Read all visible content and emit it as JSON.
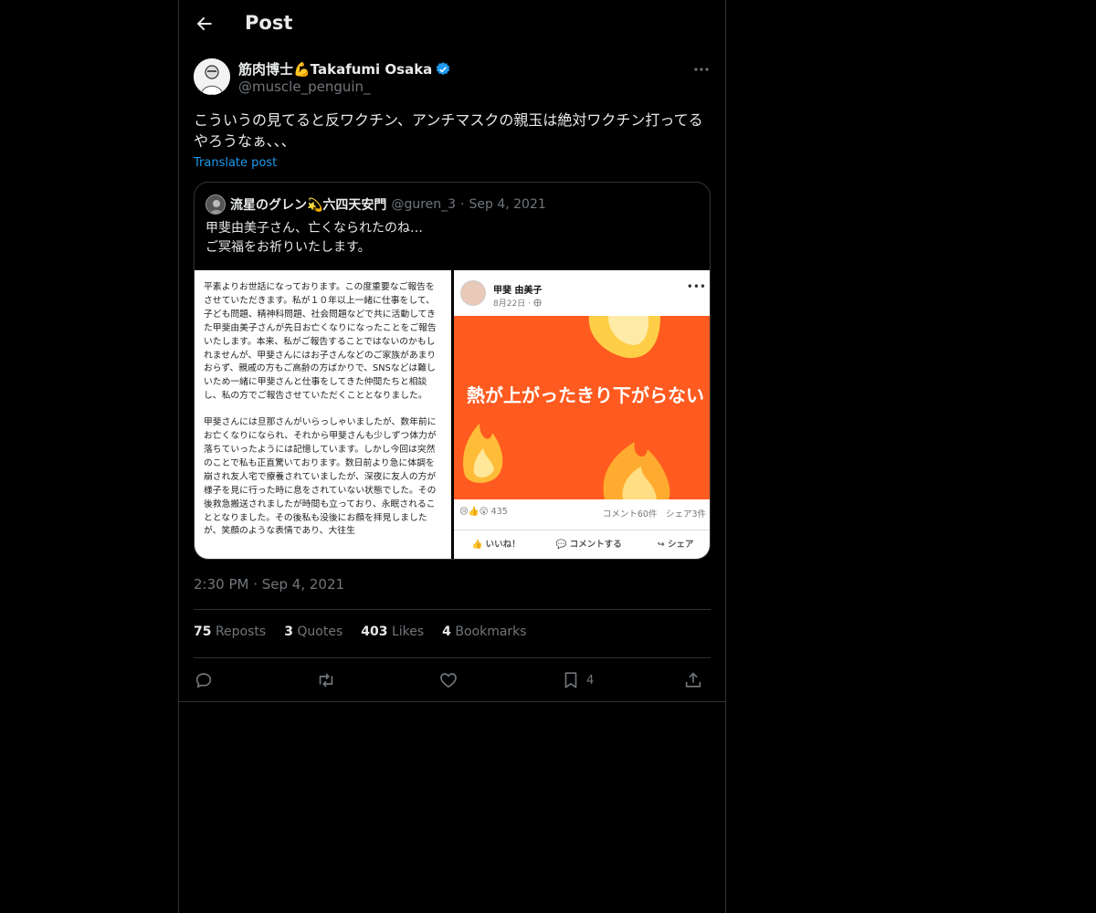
{
  "header": {
    "title": "Post"
  },
  "author": {
    "name": "筋肉博士💪Takafumi Osaka",
    "handle": "@muscle_penguin_",
    "verified": true
  },
  "post": {
    "text": "こういうの見てると反ワクチン、アンチマスクの親玉は絶対ワクチン打ってるやろうなぁ、、、",
    "translate_label": "Translate post",
    "timestamp": "2:30 PM · Sep 4, 2021"
  },
  "quote": {
    "name": "流星のグレン💫六四天安門",
    "handle": "@guren_3",
    "date": "Sep 4, 2021",
    "separator": "·",
    "text_line1": "甲斐由美子さん、亡くなられたのね…",
    "text_line2": "ご冥福をお祈りいたします。",
    "doc_paragraph1": "平素よりお世話になっております。この度重要なご報告をさせていただきます。私が１０年以上一緒に仕事をして、子ども問題、精神科問題、社会問題などで共に活動してきた甲斐由美子さんが先日お亡くなりになったことをご報告いたします。本来、私がご報告することではないのかもしれませんが、甲斐さんにはお子さんなどのご家族があまりおらず、親戚の方もご高齢の方ばかりで、SNSなどは難しいため一緒に甲斐さんと仕事をしてきた仲間たちと相談し、私の方でご報告させていただくこととなりました。",
    "doc_paragraph2": "甲斐さんには旦那さんがいらっしゃいましたが、数年前にお亡くなりになられ、それから甲斐さんも少しずつ体力が落ちていったようには記憶しています。しかし今回は突然のことで私も正直驚いております。数日前より急に体調を崩され友人宅で療養されていましたが、深夜に友人の方が様子を見に行った時に息をされていない状態でした。その後救急搬送されましたが時間も立っており、永眠されることとなりました。その後私も没後にお顔を拝見しましたが、笑顔のような表情であり、大往生",
    "fb_name": "甲斐 由美子",
    "fb_date": "8月22日 · ",
    "fb_banner": "熱が上がったきり下がらない",
    "fb_reactions": "😢👍😮 435",
    "fb_counts": "コメント60件　シェア3件",
    "fb_like": "いいね！",
    "fb_comment": "コメントする",
    "fb_share": "シェア"
  },
  "stats": [
    {
      "num": "75",
      "label": "Reposts"
    },
    {
      "num": "3",
      "label": "Quotes"
    },
    {
      "num": "403",
      "label": "Likes"
    },
    {
      "num": "4",
      "label": "Bookmarks"
    }
  ],
  "actions": {
    "bookmark_count": "4"
  },
  "icons": {
    "back": "arrow-left-icon",
    "more": "ellipsis-icon",
    "verified": "verified-badge-icon",
    "reply": "reply-icon",
    "repost": "repost-icon",
    "like": "heart-icon",
    "bookmark": "bookmark-icon",
    "share": "share-icon"
  },
  "colors": {
    "accent": "#1d9bf0",
    "muted": "#71767b",
    "banner": "#ff5a1f"
  }
}
